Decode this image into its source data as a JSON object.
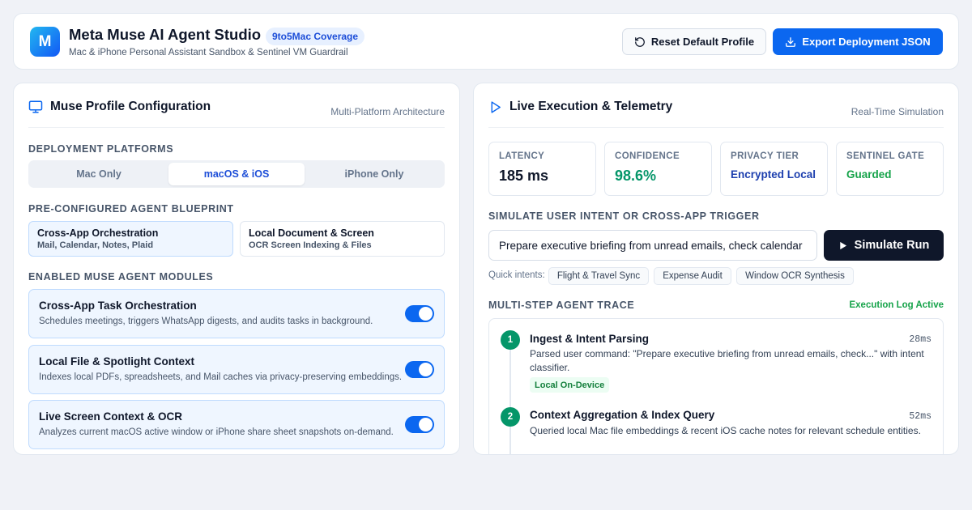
{
  "header": {
    "logo_letter": "M",
    "title": "Meta Muse AI Agent Studio",
    "badge": "9to5Mac Coverage",
    "subtitle": "Mac & iPhone Personal Assistant Sandbox & Sentinel VM Guardrail",
    "reset_label": "Reset Default Profile",
    "export_label": "Export Deployment JSON"
  },
  "profile": {
    "title": "Muse Profile Configuration",
    "meta": "Multi-Platform Architecture",
    "platforms_label": "Deployment Platforms",
    "platforms": [
      {
        "label": "Mac Only",
        "selected": false
      },
      {
        "label": "macOS & iOS",
        "selected": true
      },
      {
        "label": "iPhone Only",
        "selected": false
      }
    ],
    "blueprint_label": "Pre-Configured Agent Blueprint",
    "blueprints": [
      {
        "title": "Cross-App Orchestration",
        "subtitle": "Mail, Calendar, Notes, Plaid",
        "selected": true
      },
      {
        "title": "Local Document & Screen",
        "subtitle": "OCR Screen Indexing & Files",
        "selected": false
      }
    ],
    "modules_label": "Enabled Muse Agent Modules",
    "modules": [
      {
        "title": "Cross-App Task Orchestration",
        "description": "Schedules meetings, triggers WhatsApp digests, and audits tasks in background.",
        "enabled": true
      },
      {
        "title": "Local File & Spotlight Context",
        "description": "Indexes local PDFs, spreadsheets, and Mail caches via privacy-preserving embeddings.",
        "enabled": true
      },
      {
        "title": "Live Screen Context & OCR",
        "description": "Analyzes current macOS active window or iPhone share sheet snapshots on-demand.",
        "enabled": true
      }
    ]
  },
  "telemetry": {
    "title": "Live Execution & Telemetry",
    "meta": "Real-Time Simulation",
    "metrics": [
      {
        "label": "Latency",
        "value": "185 ms",
        "color": "#0f172a"
      },
      {
        "label": "Confidence",
        "value": "98.6%",
        "color": "#059669"
      },
      {
        "label": "Privacy Tier",
        "value": "Encrypted Local",
        "color": "#1e40af"
      },
      {
        "label": "Sentinel Gate",
        "value": "Guarded",
        "color": "#16a34a"
      }
    ],
    "intent_label": "Simulate User Intent or Cross-App Trigger",
    "intent_value": "Prepare executive briefing from unread emails, check calendar",
    "simulate_label": "Simulate Run",
    "quick_label": "Quick intents:",
    "quick_intents": [
      "Flight & Travel Sync",
      "Expense Audit",
      "Window OCR Synthesis"
    ],
    "trace_label": "Multi-Step Agent Trace",
    "trace_status": "Execution Log Active",
    "steps": [
      {
        "number": "1",
        "title": "Ingest & Intent Parsing",
        "time": "28ms",
        "description": "Parsed user command: \"Prepare executive briefing from unread emails, check...\" with intent classifier.",
        "tag": "Local On-Device"
      },
      {
        "number": "2",
        "title": "Context Aggregation & Index Query",
        "time": "52ms",
        "description": "Queried local Mac file embeddings & recent iOS cache notes for relevant schedule entities.",
        "tag": ""
      }
    ]
  },
  "colors": {
    "accent": "#0b67f0",
    "dark_button": "#0f172a",
    "success": "#059669"
  },
  "icons": {
    "reset": "rotate-ccw-icon",
    "export": "download-icon",
    "profile": "monitor-icon",
    "telemetry": "play-outline-icon",
    "simulate": "play-filled-icon"
  }
}
